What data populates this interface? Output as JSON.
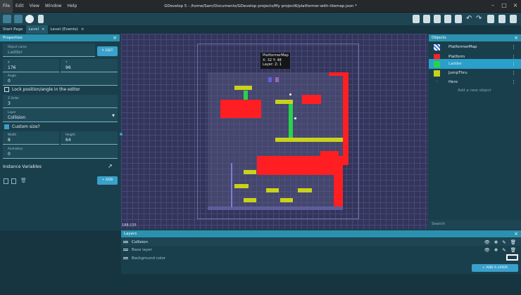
{
  "menu": [
    "File",
    "Edit",
    "View",
    "Window",
    "Help"
  ],
  "window_title": "GDevelop 5 - /home/Sam/Documents/GDevelop projects/My project6/platformer-with-tilemap.json *",
  "tabs": [
    "Start Page",
    "Level",
    "Level (Events)"
  ],
  "properties": {
    "header": "Properties",
    "object_name_label": "Object name",
    "object_name": "Ladder",
    "edit_label": "EDIT",
    "x_label": "X",
    "x": "176",
    "y_label": "Y",
    "y": "96",
    "angle_label": "Angle",
    "angle": "0",
    "lock_label": "Lock position/angle in the editor",
    "z_label": "Z Order",
    "z": "3",
    "layer_label": "Layer",
    "layer": "Collision",
    "custom_size_label": "Custom size?",
    "width_label": "Width",
    "width": "8",
    "height_label": "Height",
    "height": "64",
    "animation_label": "Animation",
    "animation": "0",
    "instance_vars": "Instance Variables",
    "add_label": "ADD"
  },
  "canvas": {
    "tooltip_name": "PlatformerMap",
    "tooltip_pos": "X: 32  Y: 48",
    "tooltip_layer": "Layer:   Z: 1",
    "coords": "188;135"
  },
  "objects": {
    "header": "Objects",
    "items": [
      {
        "name": "PlatformerMap",
        "color": "#3a6fd8"
      },
      {
        "name": "Platform",
        "color": "#ff1f23"
      },
      {
        "name": "Ladder",
        "color": "#28d24a"
      },
      {
        "name": "JumpThru",
        "color": "#c9d21a"
      },
      {
        "name": "Hero",
        "color": "#3a6fd8"
      }
    ],
    "add_new": "Add a new object",
    "search_placeholder": "Search"
  },
  "layers": {
    "header": "Layers",
    "items": [
      "Collision",
      "Base layer"
    ],
    "background": "Background color",
    "add_layer": "ADD A LAYER"
  }
}
